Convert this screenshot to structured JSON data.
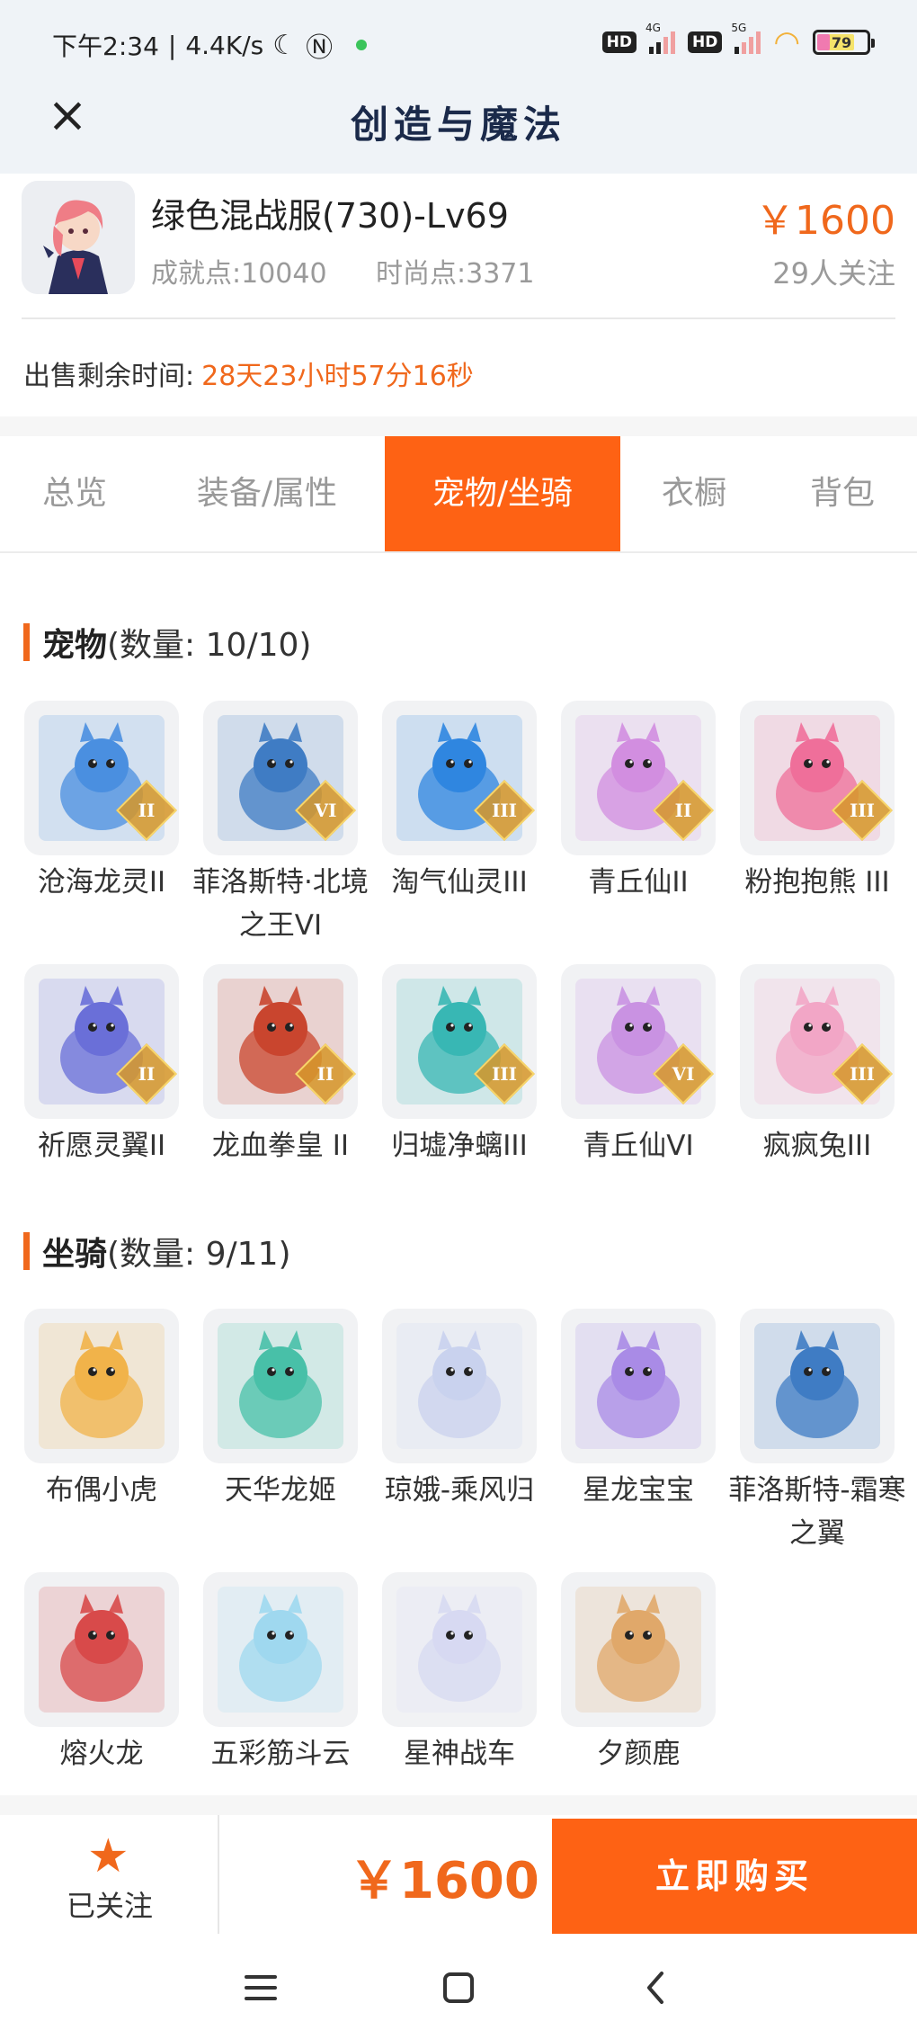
{
  "status_bar": {
    "time": "下午2:34",
    "speed": "4.4K/s",
    "net1": "4G",
    "net2": "5G",
    "hd": "HD",
    "battery": "79"
  },
  "header": {
    "title": "创造与魔法"
  },
  "product": {
    "name": "绿色混战服(730)-Lv69",
    "price": "￥1600",
    "achievement": "成就点:10040",
    "fashion": "时尚点:3371",
    "followers": "29人关注",
    "remaining_label": "出售剩余时间:",
    "remaining_value": "28天23小时57分16秒"
  },
  "tabs": [
    {
      "label": "总览"
    },
    {
      "label": "装备/属性"
    },
    {
      "label": "宠物/坐骑",
      "active": true
    },
    {
      "label": "衣橱"
    },
    {
      "label": "背包"
    }
  ],
  "pets": {
    "title": "宠物",
    "count": "(数量: 10/10)",
    "items": [
      {
        "label": "沧海龙灵II",
        "tier": "II",
        "icon": "blue-dragon-spirit",
        "color": "#4a8fe0"
      },
      {
        "label": "菲洛斯特·北境之王VI",
        "tier": "VI",
        "icon": "frost-king",
        "color": "#3f7cc4"
      },
      {
        "label": "淘气仙灵III",
        "tier": "III",
        "icon": "blue-puppy",
        "color": "#2f86e0"
      },
      {
        "label": "青丘仙II",
        "tier": "II",
        "icon": "fox-fairy",
        "color": "#d28ee0"
      },
      {
        "label": "粉抱抱熊 III",
        "tier": "III",
        "icon": "pink-bear",
        "color": "#ef6f9a"
      },
      {
        "label": "祈愿灵翼II",
        "tier": "II",
        "icon": "wish-eagle",
        "color": "#6a6fd8"
      },
      {
        "label": "龙血拳皇 II",
        "tier": "II",
        "icon": "dragon-blood-beast",
        "color": "#c9452e"
      },
      {
        "label": "归墟净螭III",
        "tier": "III",
        "icon": "jade-serpent",
        "color": "#38b7b4"
      },
      {
        "label": "青丘仙VI",
        "tier": "VI",
        "icon": "fox-fairy",
        "color": "#c992e2"
      },
      {
        "label": "疯疯兔III",
        "tier": "III",
        "icon": "crazy-rabbit",
        "color": "#f2a6c6"
      }
    ]
  },
  "mounts": {
    "title": "坐骑",
    "count": "(数量: 9/11)",
    "items": [
      {
        "label": "布偶小虎",
        "icon": "doll-tiger",
        "color": "#f1b34a"
      },
      {
        "label": "天华龙姬",
        "icon": "dragon-princess",
        "color": "#48c0a8"
      },
      {
        "label": "琼娥-乘风归",
        "icon": "moon-maiden",
        "color": "#c9d2ee"
      },
      {
        "label": "星龙宝宝",
        "icon": "star-dragon",
        "color": "#a98be6"
      },
      {
        "label": "菲洛斯特-霜寒之翼",
        "icon": "frost-wing",
        "color": "#3f7cc4"
      },
      {
        "label": "熔火龙",
        "icon": "lava-dragon",
        "color": "#d84a4a"
      },
      {
        "label": "五彩筋斗云",
        "icon": "somersault-cloud",
        "color": "#9fd8ef"
      },
      {
        "label": "星神战车",
        "icon": "star-chariot",
        "color": "#d7d9f2"
      },
      {
        "label": "夕颜鹿",
        "icon": "sunset-deer",
        "color": "#e0a86a"
      }
    ]
  },
  "bottom_bar": {
    "follow_label": "已关注",
    "price": "￥1600",
    "buy_label": "立即购买"
  }
}
